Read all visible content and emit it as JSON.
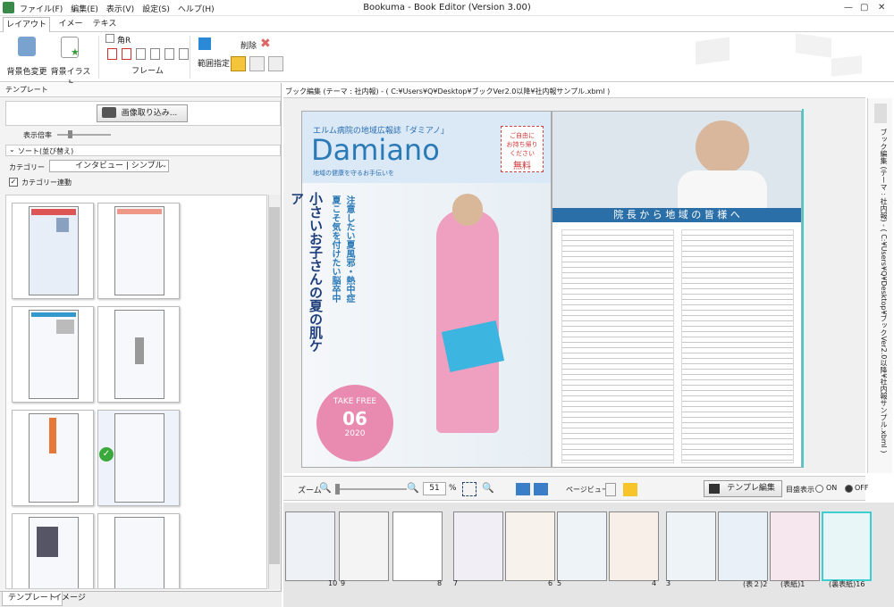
{
  "window": {
    "title": "Bookuma - Book Editor (Version 3.00)"
  },
  "menu": [
    "ファイル(F)",
    "編集(E)",
    "表示(V)",
    "設定(S)",
    "ヘルプ(H)"
  ],
  "ribbon_tabs": [
    "レイアウト",
    "イメージ",
    "テキスト"
  ],
  "ribbon": {
    "bg_color_label": "背景色変更",
    "bg_illust_label": "背景イラスト",
    "corner_r_label": "角R",
    "frame_label": "フレーム",
    "range_label": "範囲指定",
    "delete_label": "削除"
  },
  "left_panel": {
    "header": "テンプレート",
    "import_button": "画像取り込み...",
    "zoom_label": "表示倍率",
    "sort_label": "ソート(並び替え)",
    "category_label": "カテゴリー",
    "category_value": "インタビュー | シンプル",
    "category_link_label": "カテゴリー連動",
    "bottom_tabs": [
      "テンプレート",
      "イメージ"
    ]
  },
  "editor": {
    "path": "ブック編集 (テーマ : 社内報) - ( C:¥Users¥Q¥Desktop¥ブックVer2.0以降¥社内報サンプル.xbml )",
    "vertical_label": "ブック編集 (テーマ : 社内報) - ( C:¥Users¥Q¥Desktop¥ブックVer2.0以降¥社内報サンプル.xbml )"
  },
  "page_content": {
    "subtitle": "エルム病院の地域広報誌「ダミアノ」",
    "brand": "Damiano",
    "tagline": "地域の健康を守るお手伝いを",
    "badge_line1": "ご自由に",
    "badge_line2": "お持ち帰り",
    "badge_line3": "ください",
    "badge_free": "無料",
    "headline_main": "小さいお子さんの夏の肌ケア",
    "headline_sub1": "注意したい夏風邪・熱中症",
    "headline_sub2": "夏こそ気を付けたい脳卒中",
    "take_free": "TAKE FREE",
    "issue_month": "06",
    "issue_year": "2020",
    "right_title": "院 長 か ら 地 域 の 皆 様 へ"
  },
  "zoom": {
    "label": "ズーム",
    "value": "51",
    "percent": "%",
    "page_view_label": "ページビュー",
    "template_edit_button": "テンプレ編集",
    "grid_label": "目盛表示",
    "on_label": "ON",
    "off_label": "OFF"
  },
  "filmstrip": {
    "labels": [
      "10",
      "9",
      "8",
      "7",
      "6",
      "5",
      "4",
      "3",
      "(表２)2",
      "(表紙)1",
      "(裏表紙)16"
    ]
  },
  "colors": {
    "accent": "#2a7ab8",
    "pink": "#e98ab0",
    "teal": "#3ccfd0"
  }
}
